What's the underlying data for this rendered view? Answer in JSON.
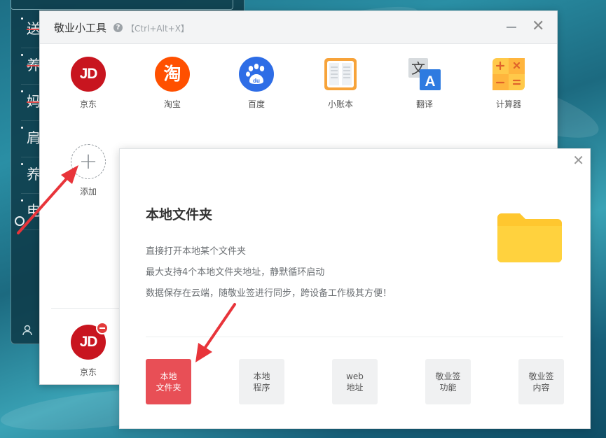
{
  "background_notes": {
    "items": [
      "送",
      "养",
      "妈",
      "肩",
      "养",
      "电"
    ]
  },
  "tool_window": {
    "title": "敬业小工具",
    "shortcut": "【Ctrl+Alt+X】",
    "tools": [
      {
        "label": "京东",
        "icon": "jd-logo-icon",
        "glyph": "JD"
      },
      {
        "label": "淘宝",
        "icon": "taobao-logo-icon",
        "glyph": "淘"
      },
      {
        "label": "百度",
        "icon": "baidu-logo-icon",
        "glyph": "du"
      },
      {
        "label": "小账本",
        "icon": "ledger-book-icon"
      },
      {
        "label": "翻译",
        "icon": "translate-icon",
        "glyph_a": "文",
        "glyph_b": "A"
      },
      {
        "label": "计算器",
        "icon": "calculator-icon"
      }
    ],
    "add_label": "添加",
    "dock": {
      "label": "京东",
      "glyph": "JD"
    }
  },
  "info_card": {
    "heading": "本地文件夹",
    "descriptions": [
      "直接打开本地某个文件夹",
      "最大支持4个本地文件夹地址，静默循环启动",
      "数据保存在云端，随敬业签进行同步，跨设备工作极其方便！"
    ],
    "options": [
      {
        "line1": "本地",
        "line2": "文件夹",
        "active": true
      },
      {
        "line1": "本地",
        "line2": "程序",
        "active": false
      },
      {
        "line1": "web",
        "line2": "地址",
        "active": false
      },
      {
        "line1": "敬业签",
        "line2": "功能",
        "active": false
      },
      {
        "line1": "敬业签",
        "line2": "内容",
        "active": false
      }
    ]
  },
  "colors": {
    "accent_red": "#e84f56",
    "jd_red": "#c8151f",
    "taobao_orange": "#ff5000",
    "baidu_blue": "#2e6de6",
    "folder_yellow": "#ffc72f",
    "annotation_arrow": "#e8343a"
  }
}
